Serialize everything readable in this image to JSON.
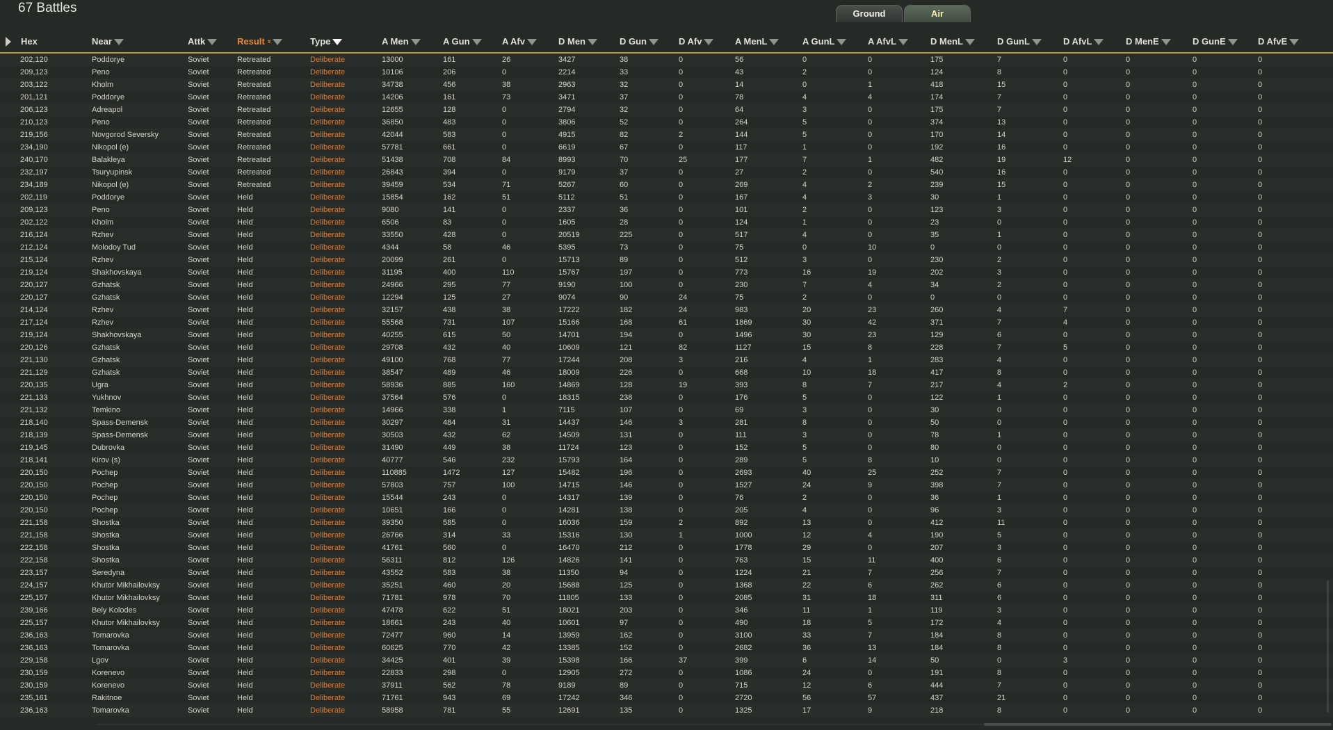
{
  "title": "67 Battles",
  "tabs": [
    {
      "label": "Ground",
      "active": true
    },
    {
      "label": "Air",
      "active": false
    }
  ],
  "colors": {
    "header_rule": "#b89a3c",
    "sorted_header": "#e08a3a",
    "type_text": "#e07a2e",
    "background": "#262a26"
  },
  "columns": [
    {
      "key": "hex",
      "label": "Hex",
      "filter": false
    },
    {
      "key": "near",
      "label": "Near",
      "filter": true
    },
    {
      "key": "attk",
      "label": "Attk",
      "filter": true
    },
    {
      "key": "result",
      "label": "Result",
      "filter": true,
      "sorted": true,
      "icon": "sort-desc-icon"
    },
    {
      "key": "type",
      "label": "Type",
      "filter": true,
      "filter_active": true
    },
    {
      "key": "amen",
      "label": "A Men",
      "filter": true
    },
    {
      "key": "agun",
      "label": "A Gun",
      "filter": true
    },
    {
      "key": "aafv",
      "label": "A Afv",
      "filter": true
    },
    {
      "key": "dmen",
      "label": "D Men",
      "filter": true
    },
    {
      "key": "dgun",
      "label": "D Gun",
      "filter": true
    },
    {
      "key": "dafv",
      "label": "D Afv",
      "filter": true
    },
    {
      "key": "amenl",
      "label": "A MenL",
      "filter": true
    },
    {
      "key": "agunl",
      "label": "A GunL",
      "filter": true
    },
    {
      "key": "aafvl",
      "label": "A AfvL",
      "filter": true
    },
    {
      "key": "dmenl",
      "label": "D MenL",
      "filter": true
    },
    {
      "key": "dgunl",
      "label": "D GunL",
      "filter": true
    },
    {
      "key": "dafvl",
      "label": "D AfvL",
      "filter": true
    },
    {
      "key": "dmene",
      "label": "D MenE",
      "filter": true
    },
    {
      "key": "dgune",
      "label": "D GunE",
      "filter": true
    },
    {
      "key": "dafve",
      "label": "D AfvE",
      "filter": true
    }
  ],
  "rows": [
    [
      "202,120",
      "Poddorye",
      "Soviet",
      "Retreated",
      "Deliberate",
      "13000",
      "161",
      "26",
      "3427",
      "38",
      "0",
      "56",
      "0",
      "0",
      "175",
      "7",
      "0",
      "0",
      "0",
      "0"
    ],
    [
      "209,123",
      "Peno",
      "Soviet",
      "Retreated",
      "Deliberate",
      "10106",
      "206",
      "0",
      "2214",
      "33",
      "0",
      "43",
      "2",
      "0",
      "124",
      "8",
      "0",
      "0",
      "0",
      "0"
    ],
    [
      "203,122",
      "Kholm",
      "Soviet",
      "Retreated",
      "Deliberate",
      "34738",
      "456",
      "38",
      "2963",
      "32",
      "0",
      "14",
      "0",
      "1",
      "418",
      "15",
      "0",
      "0",
      "0",
      "0"
    ],
    [
      "201,121",
      "Poddorye",
      "Soviet",
      "Retreated",
      "Deliberate",
      "14206",
      "161",
      "73",
      "3471",
      "37",
      "0",
      "78",
      "4",
      "4",
      "174",
      "7",
      "0",
      "0",
      "0",
      "0"
    ],
    [
      "206,123",
      "Adreapol",
      "Soviet",
      "Retreated",
      "Deliberate",
      "12655",
      "128",
      "0",
      "2794",
      "32",
      "0",
      "64",
      "3",
      "0",
      "175",
      "7",
      "0",
      "0",
      "0",
      "0"
    ],
    [
      "210,123",
      "Peno",
      "Soviet",
      "Retreated",
      "Deliberate",
      "36850",
      "483",
      "0",
      "3806",
      "52",
      "0",
      "264",
      "5",
      "0",
      "374",
      "13",
      "0",
      "0",
      "0",
      "0"
    ],
    [
      "219,156",
      "Novgorod Seversky",
      "Soviet",
      "Retreated",
      "Deliberate",
      "42044",
      "583",
      "0",
      "4915",
      "82",
      "2",
      "144",
      "5",
      "0",
      "170",
      "14",
      "0",
      "0",
      "0",
      "0"
    ],
    [
      "234,190",
      "Nikopol (e)",
      "Soviet",
      "Retreated",
      "Deliberate",
      "57781",
      "661",
      "0",
      "6619",
      "67",
      "0",
      "117",
      "1",
      "0",
      "192",
      "16",
      "0",
      "0",
      "0",
      "0"
    ],
    [
      "240,170",
      "Balakleya",
      "Soviet",
      "Retreated",
      "Deliberate",
      "51438",
      "708",
      "84",
      "8993",
      "70",
      "25",
      "177",
      "7",
      "1",
      "482",
      "19",
      "12",
      "0",
      "0",
      "0"
    ],
    [
      "232,197",
      "Tsuryupinsk",
      "Soviet",
      "Retreated",
      "Deliberate",
      "26843",
      "394",
      "0",
      "9179",
      "37",
      "0",
      "27",
      "2",
      "0",
      "540",
      "16",
      "0",
      "0",
      "0",
      "0"
    ],
    [
      "234,189",
      "Nikopol (e)",
      "Soviet",
      "Retreated",
      "Deliberate",
      "39459",
      "534",
      "71",
      "5267",
      "60",
      "0",
      "269",
      "4",
      "2",
      "239",
      "15",
      "0",
      "0",
      "0",
      "0"
    ],
    [
      "202,119",
      "Poddorye",
      "Soviet",
      "Held",
      "Deliberate",
      "15854",
      "162",
      "51",
      "5112",
      "51",
      "0",
      "167",
      "4",
      "3",
      "30",
      "1",
      "0",
      "0",
      "0",
      "0"
    ],
    [
      "209,123",
      "Peno",
      "Soviet",
      "Held",
      "Deliberate",
      "9080",
      "141",
      "0",
      "2337",
      "36",
      "0",
      "101",
      "2",
      "0",
      "123",
      "3",
      "0",
      "0",
      "0",
      "0"
    ],
    [
      "202,122",
      "Kholm",
      "Soviet",
      "Held",
      "Deliberate",
      "6506",
      "83",
      "0",
      "1605",
      "28",
      "0",
      "124",
      "1",
      "0",
      "23",
      "0",
      "0",
      "0",
      "0",
      "0"
    ],
    [
      "216,124",
      "Rzhev",
      "Soviet",
      "Held",
      "Deliberate",
      "33550",
      "428",
      "0",
      "20519",
      "225",
      "0",
      "517",
      "4",
      "0",
      "35",
      "1",
      "0",
      "0",
      "0",
      "0"
    ],
    [
      "212,124",
      "Molodoy Tud",
      "Soviet",
      "Held",
      "Deliberate",
      "4344",
      "58",
      "46",
      "5395",
      "73",
      "0",
      "75",
      "0",
      "10",
      "0",
      "0",
      "0",
      "0",
      "0",
      "0"
    ],
    [
      "215,124",
      "Rzhev",
      "Soviet",
      "Held",
      "Deliberate",
      "20099",
      "261",
      "0",
      "15713",
      "89",
      "0",
      "512",
      "3",
      "0",
      "230",
      "2",
      "0",
      "0",
      "0",
      "0"
    ],
    [
      "219,124",
      "Shakhovskaya",
      "Soviet",
      "Held",
      "Deliberate",
      "31195",
      "400",
      "110",
      "15767",
      "197",
      "0",
      "773",
      "16",
      "19",
      "202",
      "3",
      "0",
      "0",
      "0",
      "0"
    ],
    [
      "220,127",
      "Gzhatsk",
      "Soviet",
      "Held",
      "Deliberate",
      "24966",
      "295",
      "77",
      "9190",
      "100",
      "0",
      "230",
      "7",
      "4",
      "34",
      "2",
      "0",
      "0",
      "0",
      "0"
    ],
    [
      "220,127",
      "Gzhatsk",
      "Soviet",
      "Held",
      "Deliberate",
      "12294",
      "125",
      "27",
      "9074",
      "90",
      "24",
      "75",
      "2",
      "0",
      "0",
      "0",
      "0",
      "0",
      "0",
      "0"
    ],
    [
      "214,124",
      "Rzhev",
      "Soviet",
      "Held",
      "Deliberate",
      "32157",
      "438",
      "38",
      "17222",
      "182",
      "24",
      "983",
      "20",
      "23",
      "260",
      "4",
      "7",
      "0",
      "0",
      "0"
    ],
    [
      "217,124",
      "Rzhev",
      "Soviet",
      "Held",
      "Deliberate",
      "55568",
      "731",
      "107",
      "15166",
      "168",
      "61",
      "1869",
      "30",
      "42",
      "371",
      "7",
      "4",
      "0",
      "0",
      "0"
    ],
    [
      "219,124",
      "Shakhovskaya",
      "Soviet",
      "Held",
      "Deliberate",
      "40255",
      "615",
      "50",
      "14701",
      "194",
      "0",
      "1496",
      "30",
      "23",
      "129",
      "6",
      "0",
      "0",
      "0",
      "0"
    ],
    [
      "220,126",
      "Gzhatsk",
      "Soviet",
      "Held",
      "Deliberate",
      "29708",
      "432",
      "40",
      "10609",
      "121",
      "82",
      "1127",
      "15",
      "8",
      "228",
      "7",
      "5",
      "0",
      "0",
      "0"
    ],
    [
      "221,130",
      "Gzhatsk",
      "Soviet",
      "Held",
      "Deliberate",
      "49100",
      "768",
      "77",
      "17244",
      "208",
      "3",
      "216",
      "4",
      "1",
      "283",
      "4",
      "0",
      "0",
      "0",
      "0"
    ],
    [
      "221,129",
      "Gzhatsk",
      "Soviet",
      "Held",
      "Deliberate",
      "38547",
      "489",
      "46",
      "18009",
      "226",
      "0",
      "668",
      "10",
      "18",
      "417",
      "8",
      "0",
      "0",
      "0",
      "0"
    ],
    [
      "220,135",
      "Ugra",
      "Soviet",
      "Held",
      "Deliberate",
      "58936",
      "885",
      "160",
      "14869",
      "128",
      "19",
      "393",
      "8",
      "7",
      "217",
      "4",
      "2",
      "0",
      "0",
      "0"
    ],
    [
      "221,133",
      "Yukhnov",
      "Soviet",
      "Held",
      "Deliberate",
      "37564",
      "576",
      "0",
      "18315",
      "238",
      "0",
      "176",
      "5",
      "0",
      "122",
      "1",
      "0",
      "0",
      "0",
      "0"
    ],
    [
      "221,132",
      "Temkino",
      "Soviet",
      "Held",
      "Deliberate",
      "14966",
      "338",
      "1",
      "7115",
      "107",
      "0",
      "69",
      "3",
      "0",
      "30",
      "0",
      "0",
      "0",
      "0",
      "0"
    ],
    [
      "218,140",
      "Spass-Demensk",
      "Soviet",
      "Held",
      "Deliberate",
      "30297",
      "484",
      "31",
      "14437",
      "146",
      "3",
      "281",
      "8",
      "0",
      "50",
      "0",
      "0",
      "0",
      "0",
      "0"
    ],
    [
      "218,139",
      "Spass-Demensk",
      "Soviet",
      "Held",
      "Deliberate",
      "30503",
      "432",
      "62",
      "14509",
      "131",
      "0",
      "111",
      "3",
      "0",
      "78",
      "1",
      "0",
      "0",
      "0",
      "0"
    ],
    [
      "219,145",
      "Dubrovka",
      "Soviet",
      "Held",
      "Deliberate",
      "31490",
      "449",
      "38",
      "11724",
      "123",
      "0",
      "152",
      "5",
      "0",
      "80",
      "0",
      "0",
      "0",
      "0",
      "0"
    ],
    [
      "218,141",
      "Kirov (s)",
      "Soviet",
      "Held",
      "Deliberate",
      "40777",
      "546",
      "232",
      "15793",
      "164",
      "0",
      "289",
      "5",
      "8",
      "10",
      "0",
      "0",
      "0",
      "0",
      "0"
    ],
    [
      "220,150",
      "Pochep",
      "Soviet",
      "Held",
      "Deliberate",
      "110885",
      "1472",
      "127",
      "15482",
      "196",
      "0",
      "2693",
      "40",
      "25",
      "252",
      "7",
      "0",
      "0",
      "0",
      "0"
    ],
    [
      "220,150",
      "Pochep",
      "Soviet",
      "Held",
      "Deliberate",
      "57803",
      "757",
      "100",
      "14715",
      "146",
      "0",
      "1527",
      "24",
      "9",
      "398",
      "7",
      "0",
      "0",
      "0",
      "0"
    ],
    [
      "220,150",
      "Pochep",
      "Soviet",
      "Held",
      "Deliberate",
      "15544",
      "243",
      "0",
      "14317",
      "139",
      "0",
      "76",
      "2",
      "0",
      "36",
      "1",
      "0",
      "0",
      "0",
      "0"
    ],
    [
      "220,150",
      "Pochep",
      "Soviet",
      "Held",
      "Deliberate",
      "10651",
      "166",
      "0",
      "14281",
      "138",
      "0",
      "205",
      "4",
      "0",
      "96",
      "3",
      "0",
      "0",
      "0",
      "0"
    ],
    [
      "221,158",
      "Shostka",
      "Soviet",
      "Held",
      "Deliberate",
      "39350",
      "585",
      "0",
      "16036",
      "159",
      "2",
      "892",
      "13",
      "0",
      "412",
      "11",
      "0",
      "0",
      "0",
      "0"
    ],
    [
      "221,158",
      "Shostka",
      "Soviet",
      "Held",
      "Deliberate",
      "26766",
      "314",
      "33",
      "15316",
      "130",
      "1",
      "1000",
      "12",
      "4",
      "190",
      "5",
      "0",
      "0",
      "0",
      "0"
    ],
    [
      "222,158",
      "Shostka",
      "Soviet",
      "Held",
      "Deliberate",
      "41761",
      "560",
      "0",
      "16470",
      "212",
      "0",
      "1778",
      "29",
      "0",
      "207",
      "3",
      "0",
      "0",
      "0",
      "0"
    ],
    [
      "222,158",
      "Shostka",
      "Soviet",
      "Held",
      "Deliberate",
      "56311",
      "812",
      "126",
      "14826",
      "141",
      "0",
      "763",
      "15",
      "11",
      "400",
      "6",
      "0",
      "0",
      "0",
      "0"
    ],
    [
      "223,157",
      "Seredyna",
      "Soviet",
      "Held",
      "Deliberate",
      "43552",
      "583",
      "38",
      "11350",
      "94",
      "0",
      "1224",
      "21",
      "7",
      "256",
      "7",
      "0",
      "0",
      "0",
      "0"
    ],
    [
      "224,157",
      "Khutor Mikhailovksy",
      "Soviet",
      "Held",
      "Deliberate",
      "35251",
      "460",
      "20",
      "15688",
      "125",
      "0",
      "1368",
      "22",
      "6",
      "262",
      "6",
      "0",
      "0",
      "0",
      "0"
    ],
    [
      "225,157",
      "Khutor Mikhailovksy",
      "Soviet",
      "Held",
      "Deliberate",
      "71781",
      "978",
      "70",
      "11805",
      "133",
      "0",
      "2085",
      "31",
      "18",
      "311",
      "6",
      "0",
      "0",
      "0",
      "0"
    ],
    [
      "239,166",
      "Bely Kolodes",
      "Soviet",
      "Held",
      "Deliberate",
      "47478",
      "622",
      "51",
      "18021",
      "203",
      "0",
      "346",
      "11",
      "1",
      "119",
      "3",
      "0",
      "0",
      "0",
      "0"
    ],
    [
      "225,157",
      "Khutor Mikhailovksy",
      "Soviet",
      "Held",
      "Deliberate",
      "18661",
      "243",
      "40",
      "10601",
      "97",
      "0",
      "490",
      "18",
      "5",
      "172",
      "4",
      "0",
      "0",
      "0",
      "0"
    ],
    [
      "236,163",
      "Tomarovka",
      "Soviet",
      "Held",
      "Deliberate",
      "72477",
      "960",
      "14",
      "13959",
      "162",
      "0",
      "3100",
      "33",
      "7",
      "184",
      "8",
      "0",
      "0",
      "0",
      "0"
    ],
    [
      "236,163",
      "Tomarovka",
      "Soviet",
      "Held",
      "Deliberate",
      "60625",
      "770",
      "42",
      "13385",
      "152",
      "0",
      "2682",
      "36",
      "13",
      "184",
      "8",
      "0",
      "0",
      "0",
      "0"
    ],
    [
      "229,158",
      "Lgov",
      "Soviet",
      "Held",
      "Deliberate",
      "34425",
      "401",
      "39",
      "15398",
      "166",
      "37",
      "399",
      "6",
      "14",
      "50",
      "0",
      "3",
      "0",
      "0",
      "0"
    ],
    [
      "230,159",
      "Korenevo",
      "Soviet",
      "Held",
      "Deliberate",
      "22833",
      "298",
      "0",
      "12905",
      "272",
      "0",
      "1086",
      "24",
      "0",
      "191",
      "8",
      "0",
      "0",
      "0",
      "0"
    ],
    [
      "230,159",
      "Korenevo",
      "Soviet",
      "Held",
      "Deliberate",
      "37911",
      "562",
      "78",
      "9189",
      "89",
      "0",
      "715",
      "12",
      "6",
      "444",
      "7",
      "0",
      "0",
      "0",
      "0"
    ],
    [
      "235,161",
      "Rakitnoe",
      "Soviet",
      "Held",
      "Deliberate",
      "71761",
      "943",
      "69",
      "17242",
      "346",
      "0",
      "2720",
      "56",
      "57",
      "437",
      "21",
      "0",
      "0",
      "0",
      "0"
    ],
    [
      "236,163",
      "Tomarovka",
      "Soviet",
      "Held",
      "Deliberate",
      "58958",
      "781",
      "55",
      "12691",
      "135",
      "0",
      "1325",
      "17",
      "9",
      "218",
      "8",
      "0",
      "0",
      "0",
      "0"
    ]
  ]
}
